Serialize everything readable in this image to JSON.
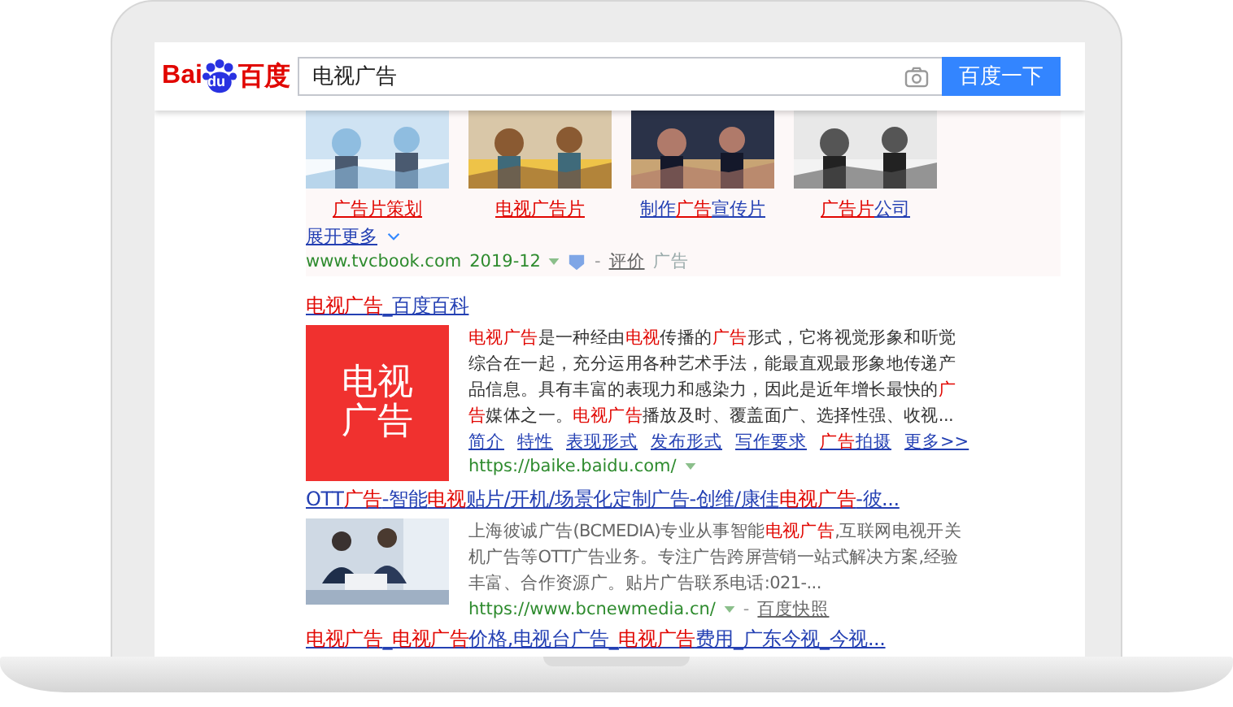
{
  "header": {
    "logo": {
      "left": "Bai",
      "paw": "du",
      "right": "百度"
    },
    "query": "电视广告",
    "button": "百度一下"
  },
  "ad": {
    "items": [
      {
        "caption": "**广告片策划**"
      },
      {
        "caption": "**电视广告片**"
      },
      {
        "caption": "制作**广告**宣传片"
      },
      {
        "caption": "**广告片**公司"
      }
    ],
    "expand": "展开更多",
    "url": "www.tvcbook.com",
    "date": "2019-12",
    "separator": "-",
    "rate": "评价",
    "tag": "广告"
  },
  "results": [
    {
      "kind": "baike",
      "title": "**电视广告**_百度百科",
      "thumb_text": "电视广告",
      "snippet": "**电视广告**是一种经由**电视**传播的**广告**形式，它将视觉形象和听觉综合在一起，充分运用各种艺术手法，能最直观最形象地传递产品信息。具有丰富的表现力和感染力，因此是近年增长最快的**广告**媒体之一。**电视广告**播放及时、覆盖面广、选择性强、收视...",
      "links": [
        "简介",
        "特性",
        "表现形式",
        "发布形式",
        "写作要求",
        "**广告**拍摄",
        "更多>>"
      ],
      "url": "https://baike.baidu.com/"
    },
    {
      "title": "OTT**广告**-智能**电视**贴片/开机/场景化定制广告-创维/康佳**电视广告**-彼...",
      "snippet": "上海彼诚广告(BCMEDIA)专业从事智能**电视广告**,互联网电视开关机广告等OTT广告业务。专注广告跨屏营销一站式解决方案,经验丰富、合作资源广。贴片广告联系电话:021-...",
      "url": "https://www.bcnewmedia.cn/",
      "separator": "-",
      "cache": "百度快照"
    },
    {
      "kind": "plain",
      "title": "**电视广告**_**电视广告**价格,电视台广告_**电视广告**费用_广东今视_今视..."
    }
  ]
}
